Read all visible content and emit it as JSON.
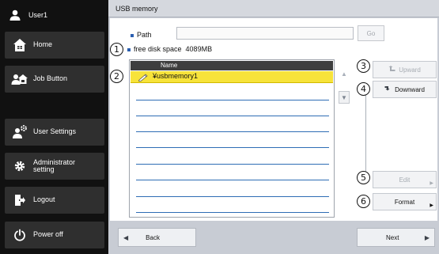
{
  "sidebar": {
    "user_name": "User1",
    "items": [
      {
        "label": "Home",
        "icon": "home-icon"
      },
      {
        "label": "Job Button",
        "icon": "job-button-icon"
      },
      {
        "label": "User Settings",
        "icon": "user-settings-icon"
      },
      {
        "label_line1": "Administrator",
        "label_line2": "setting",
        "icon": "admin-gear-icon"
      },
      {
        "label": "Logout",
        "icon": "logout-icon"
      },
      {
        "label": "Power off",
        "icon": "power-icon"
      }
    ]
  },
  "main": {
    "title": "USB memory",
    "path_label": "Path",
    "path_value": "",
    "go_label": "Go",
    "free_space_label": "free disk space",
    "free_space_value": "4089MB",
    "list": {
      "column_header": "Name",
      "rows": [
        {
          "label": "¥usbmemory1",
          "selected": true
        }
      ]
    },
    "callouts": [
      "1",
      "2",
      "3",
      "4",
      "5",
      "6"
    ],
    "buttons": {
      "upward": "Upward",
      "downward": "Downward",
      "edit": "Edit",
      "format": "Format"
    }
  },
  "nav": {
    "back": "Back",
    "next": "Next"
  },
  "colors": {
    "sidebar_bg": "#111111",
    "selected_row": "#f7e33a",
    "row_line": "#2e6db5",
    "bullet": "#2b5fb0"
  }
}
